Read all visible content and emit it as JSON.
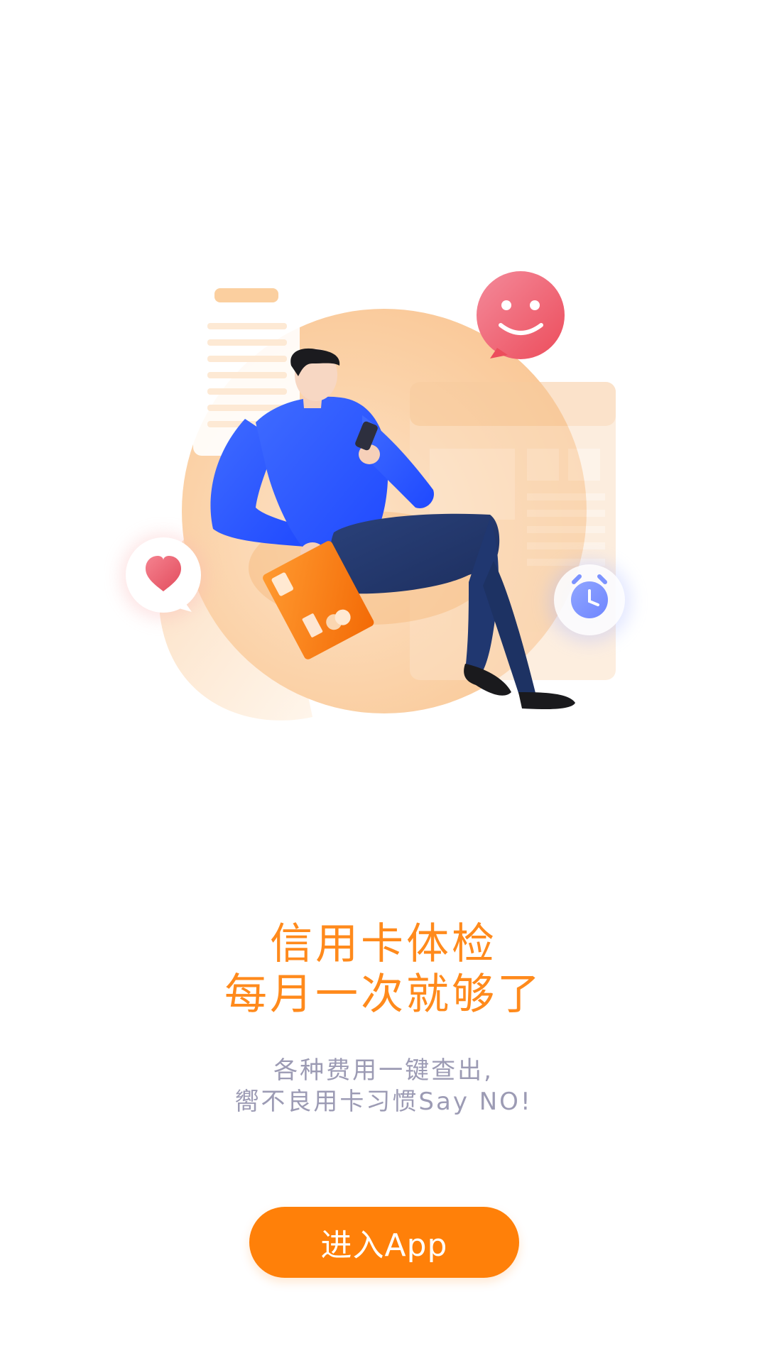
{
  "headline": {
    "line1": "信用卡体检",
    "line2": "每月一次就够了"
  },
  "description": {
    "line1": "各种费用一键查出,",
    "line2": "嚮不良用卡习惯Say NO!"
  },
  "enter_button": {
    "label": "进入App"
  },
  "colors": {
    "accent": "#ff8009",
    "headline": "#ff8a1c",
    "description": "#9c9bb4",
    "shirt": "#2f5cff",
    "pants": "#23396b"
  },
  "illustration": {
    "icons": [
      "smiley-chat-icon",
      "heart-chat-icon",
      "alarm-clock-icon",
      "credit-card-icon",
      "phone-icon",
      "document-icon"
    ]
  }
}
